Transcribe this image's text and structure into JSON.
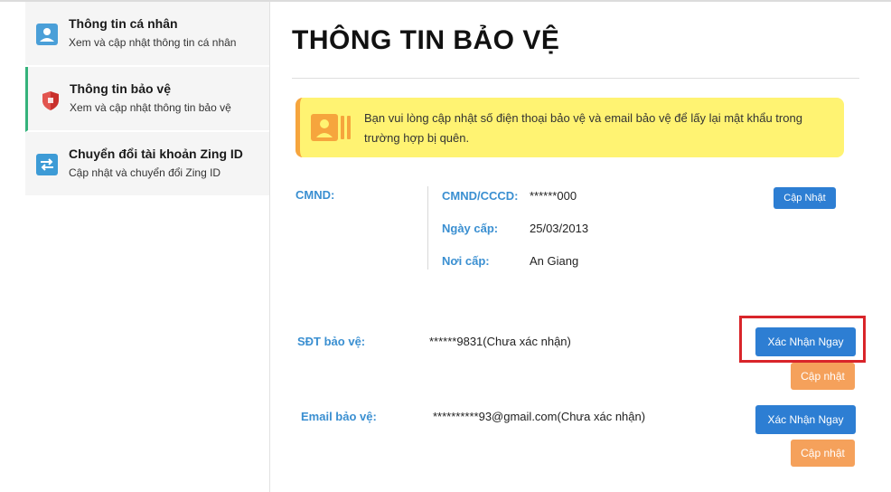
{
  "sidebar": {
    "items": [
      {
        "title": "Thông tin cá nhân",
        "subtitle": "Xem và cập nhật thông tin cá nhân",
        "icon": "user-card-icon"
      },
      {
        "title": "Thông tin bảo vệ",
        "subtitle": "Xem và cập nhật thông tin bảo vệ",
        "icon": "shield-icon",
        "active": true
      },
      {
        "title": "Chuyển đổi tài khoản Zing ID",
        "subtitle": "Cập nhật và chuyển đổi Zing ID",
        "icon": "exchange-icon"
      }
    ]
  },
  "main": {
    "title": "THÔNG TIN BẢO VỆ",
    "notice": {
      "text": "Bạn vui lòng cập nhật số điện thoại bảo vệ và email bảo vệ để lấy lại mật khẩu trong trường hợp bị quên.",
      "icon": "id-card-icon"
    },
    "cmnd": {
      "label": "CMND:",
      "fields": [
        {
          "label": "CMND/CCCD:",
          "value": "******000"
        },
        {
          "label": "Ngày cấp:",
          "value": "25/03/2013"
        },
        {
          "label": "Nơi cấp:",
          "value": "An Giang"
        }
      ],
      "update_button": "Cập Nhật"
    },
    "phone": {
      "label": "SĐT bảo vệ:",
      "value": "******9831(Chưa xác nhận)",
      "confirm_button": "Xác Nhận Ngay",
      "update_button": "Cập nhật"
    },
    "email": {
      "label": "Email bảo vệ:",
      "value": "**********93@gmail.com(Chưa xác nhận)",
      "confirm_button": "Xác Nhận Ngay",
      "update_button": "Cập nhật"
    }
  },
  "colors": {
    "accent_blue": "#2d7ed3",
    "label_blue": "#3a8fd1",
    "orange": "#f5a15b",
    "notice_bg": "#fff372",
    "active_bar": "#34b27b",
    "highlight": "#d9252a"
  }
}
